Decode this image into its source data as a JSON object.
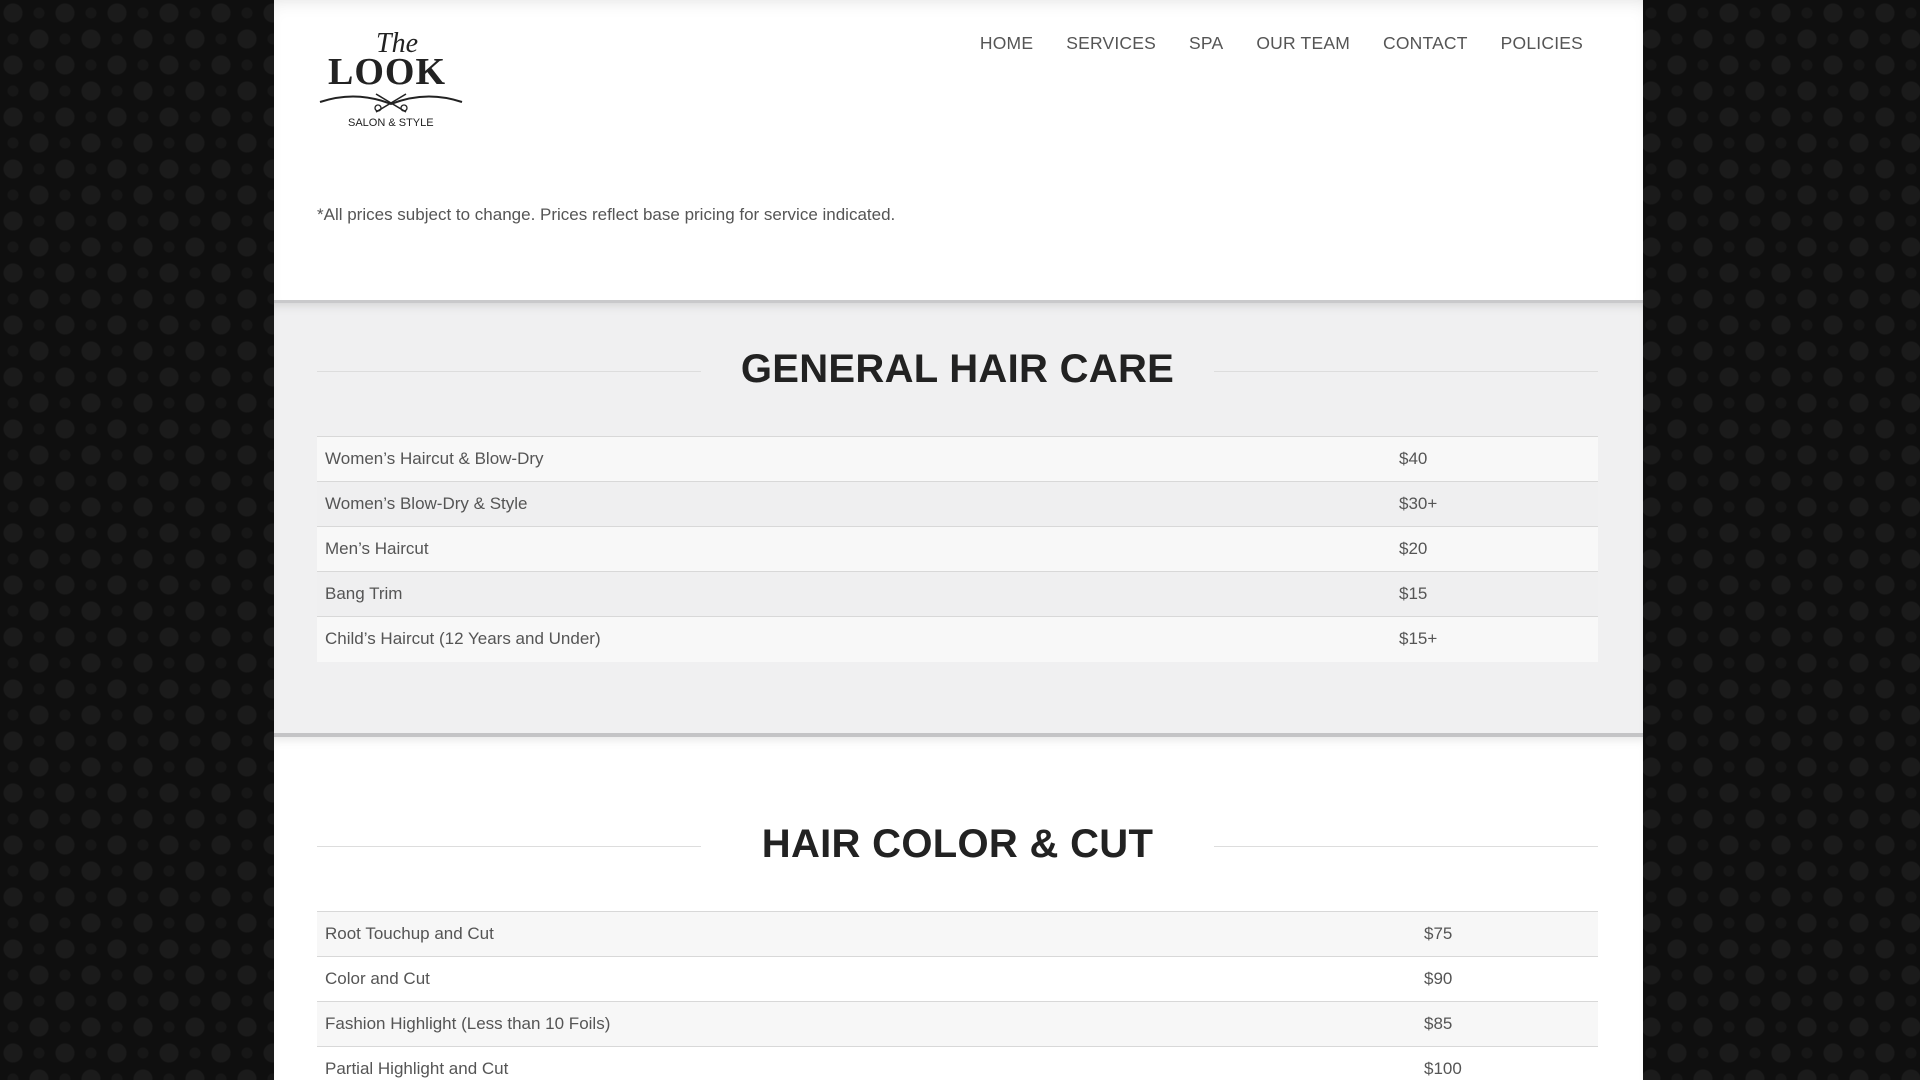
{
  "logo": {
    "line1": "The",
    "line2": "LOOK",
    "line3": "SALON & STYLE"
  },
  "nav": [
    "HOME",
    "SERVICES",
    "SPA",
    "OUR TEAM",
    "CONTACT",
    "POLICIES"
  ],
  "disclaimer": "*All prices subject to change. Prices reflect base pricing for service indicated.",
  "sections": [
    {
      "title": "GENERAL HAIR CARE",
      "items": [
        {
          "name": "Women’s Haircut & Blow-Dry",
          "price": "$40"
        },
        {
          "name": "Women’s Blow-Dry & Style",
          "price": "$30+"
        },
        {
          "name": "Men’s Haircut",
          "price": "$20"
        },
        {
          "name": "Bang Trim",
          "price": "$15"
        },
        {
          "name": "Child’s Haircut (12 Years and Under)",
          "price": "$15+"
        }
      ]
    },
    {
      "title": "HAIR COLOR & CUT",
      "items": [
        {
          "name": "Root Touchup and Cut",
          "price": "$75"
        },
        {
          "name": "Color and Cut",
          "price": "$90"
        },
        {
          "name": "Fashion Highlight (Less than 10 Foils)",
          "price": "$85"
        },
        {
          "name": "Partial Highlight and Cut",
          "price": "$100"
        }
      ]
    }
  ],
  "colors": {
    "background": "#0f0f0f",
    "heading": "#222222",
    "text": "#555555",
    "gray_section": "#f0f0f1"
  }
}
